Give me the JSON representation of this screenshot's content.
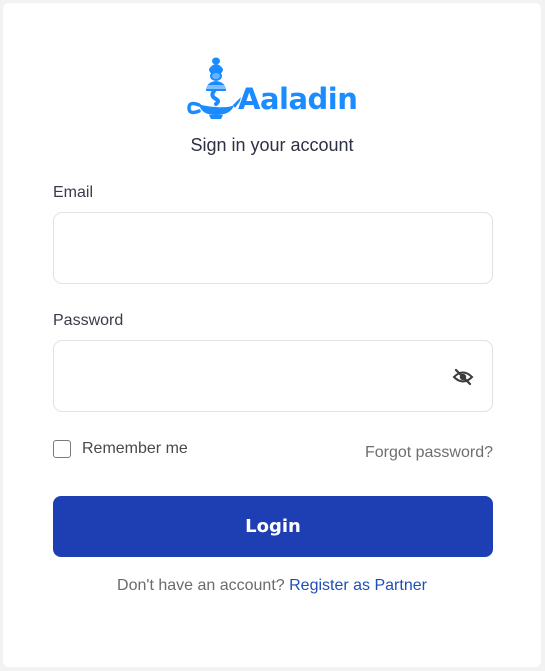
{
  "brand": {
    "name": "Aaladin",
    "color": "#1a8cff",
    "logo_icon": "genie-lamp-icon"
  },
  "header": {
    "subtitle": "Sign in your account"
  },
  "form": {
    "email": {
      "label": "Email",
      "value": "",
      "placeholder": ""
    },
    "password": {
      "label": "Password",
      "value": "",
      "placeholder": "",
      "toggle_icon": "eye-slash-icon"
    },
    "remember": {
      "label": "Remember me",
      "checked": false
    },
    "forgot_label": "Forgot password?",
    "login_label": "Login",
    "login_color": "#1e3fb4"
  },
  "footer": {
    "prompt": "Don't have an account?",
    "register_label": "Register as Partner",
    "link_color": "#1f4fb5"
  }
}
